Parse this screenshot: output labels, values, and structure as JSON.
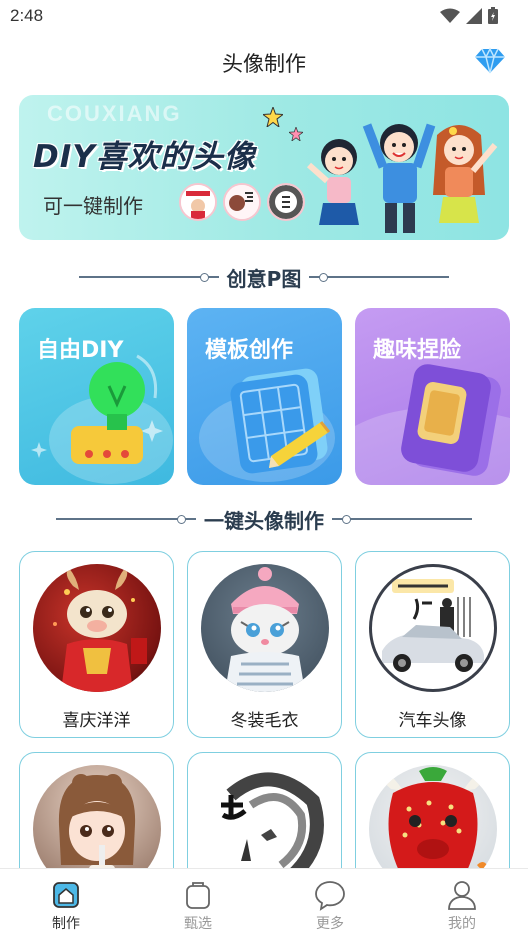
{
  "status_bar": {
    "time": "2:48"
  },
  "header": {
    "title": "头像制作",
    "vip_icon": "diamond-icon"
  },
  "banner": {
    "bg_text": "COUXIANG",
    "title": "DIY喜欢的头像",
    "subtitle": "可一键制作",
    "sample_avatars": [
      "avatar-sample-1",
      "avatar-sample-2",
      "avatar-sample-3"
    ]
  },
  "creative_section": {
    "title": "创意P图"
  },
  "tools": [
    {
      "label": "自由DIY",
      "icon": "lightbulb-icon"
    },
    {
      "label": "模板创作",
      "icon": "grid-pencil-icon"
    },
    {
      "label": "趣味捏脸",
      "icon": "phone-icon"
    }
  ],
  "oneclick_section": {
    "title": "一键头像制作"
  },
  "avatars": [
    {
      "name": "喜庆洋洋"
    },
    {
      "name": "冬装毛衣"
    },
    {
      "name": "汽车头像"
    },
    {
      "name": ""
    },
    {
      "name": ""
    },
    {
      "name": ""
    }
  ],
  "bottom_nav": [
    {
      "label": "制作",
      "icon": "home-icon",
      "active": true
    },
    {
      "label": "甄选",
      "icon": "bag-icon",
      "active": false
    },
    {
      "label": "更多",
      "icon": "chat-bubble-icon",
      "active": false
    },
    {
      "label": "我的",
      "icon": "user-icon",
      "active": false
    }
  ],
  "colors": {
    "accent": "#3fb9e0",
    "card_border": "#7fcfe0",
    "title_text": "#2b3d4f"
  }
}
